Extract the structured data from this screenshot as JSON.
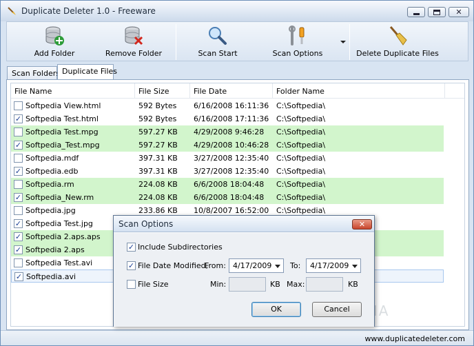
{
  "window": {
    "title": "Duplicate Deleter 1.0 - Freeware"
  },
  "toolbar": {
    "add_folder": "Add Folder",
    "remove_folder": "Remove Folder",
    "scan_start": "Scan Start",
    "scan_options": "Scan Options",
    "delete_duplicates": "Delete Duplicate Files"
  },
  "tabs": [
    {
      "label": "Scan Folders"
    },
    {
      "label": "Duplicate Files"
    }
  ],
  "table": {
    "columns": [
      "File Name",
      "File Size",
      "File Date",
      "Folder Name"
    ],
    "rows": [
      {
        "checked": false,
        "name": "Softpedia View.html",
        "size": "592 Bytes",
        "date": "6/16/2008 16:11:36",
        "folder": "C:\\Softpedia\\"
      },
      {
        "checked": true,
        "name": "Softpedia Test.html",
        "size": "592 Bytes",
        "date": "6/16/2008 17:11:36",
        "folder": "C:\\Softpedia\\"
      },
      {
        "checked": false,
        "name": "Softpedia Test.mpg",
        "size": "597.27 KB",
        "date": "4/29/2008 9:46:28",
        "folder": "C:\\Softpedia\\"
      },
      {
        "checked": true,
        "name": "Softpedia_Test.mpg",
        "size": "597.27 KB",
        "date": "4/29/2008 10:46:28",
        "folder": "C:\\Softpedia\\"
      },
      {
        "checked": false,
        "name": "Softpedia.mdf",
        "size": "397.31 KB",
        "date": "3/27/2008 12:35:40",
        "folder": "C:\\Softpedia\\"
      },
      {
        "checked": true,
        "name": "Softpedia.edb",
        "size": "397.31 KB",
        "date": "3/27/2008 12:35:40",
        "folder": "C:\\Softpedia\\"
      },
      {
        "checked": false,
        "name": "Softpedia.rm",
        "size": "224.08 KB",
        "date": "6/6/2008 18:04:48",
        "folder": "C:\\Softpedia\\"
      },
      {
        "checked": true,
        "name": "Softpedia_New.rm",
        "size": "224.08 KB",
        "date": "6/6/2008 18:04:48",
        "folder": "C:\\Softpedia\\"
      },
      {
        "checked": false,
        "name": "Softpedia.jpg",
        "size": "233.86 KB",
        "date": "10/8/2007 16:52:00",
        "folder": "C:\\Softpedia\\"
      },
      {
        "checked": true,
        "name": "Softpedia Test.jpg",
        "size": "",
        "date": "",
        "folder": ""
      },
      {
        "checked": true,
        "name": "Softpedia 2.aps.aps",
        "size": "",
        "date": "",
        "folder": ""
      },
      {
        "checked": true,
        "name": "Softpedia 2.aps",
        "size": "",
        "date": "",
        "folder": ""
      },
      {
        "checked": false,
        "name": "Softpedia Test.avi",
        "size": "",
        "date": "",
        "folder": ""
      },
      {
        "checked": true,
        "name": "Softpedia.avi",
        "size": "",
        "date": "",
        "folder": ""
      }
    ]
  },
  "dialog": {
    "title": "Scan Options",
    "include_subdirs": {
      "label": "Include Subdirectories",
      "checked": true
    },
    "date_modified": {
      "label": "File Date Modified,",
      "checked": true,
      "from_label": "From:",
      "from_value": "4/17/2009",
      "to_label": "To:",
      "to_value": "4/17/2009"
    },
    "file_size": {
      "label": "File Size",
      "checked": false,
      "min_label": "Min:",
      "min_unit": "KB",
      "max_label": "Max:",
      "max_unit": "KB"
    },
    "ok": "OK",
    "cancel": "Cancel"
  },
  "status": {
    "url": "www.duplicatedeleter.com"
  },
  "watermark": "SOFTPEDIA"
}
